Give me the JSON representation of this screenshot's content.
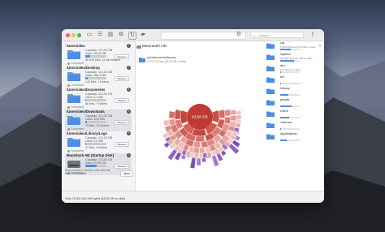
{
  "toolbar": {
    "search_placeholder": "Search"
  },
  "sidebar": {
    "cards": [
      {
        "title": "/Users/alex",
        "capacity": "Capacity: 121,03 GB",
        "used": "Used: 28,09 GB",
        "files": "56 640 files, 12 840 folders",
        "measure": "Measure",
        "status": "Completed",
        "usage": 0.23,
        "selected": false
      },
      {
        "title": "/Users/alex/Desktop",
        "capacity": "Capacity: 121,03 GB",
        "used": "Used: 465,3 MB",
        "files": "143 files, 7 folders",
        "measure": "Measure",
        "status": "Completed",
        "usage": 0.1,
        "selected": false
      },
      {
        "title": "/Users/alex/Documents",
        "capacity": "Capacity: 121,03 GB",
        "used": "Used: 3,1 MB",
        "files": "86 files, 7 folders",
        "measure": "Measure",
        "status": "Completed",
        "usage": 0.05,
        "selected": false
      },
      {
        "title": "/Users/alex/Downloads",
        "capacity": "Capacity: 121,03 GB",
        "used": "Used: 43,8 MB",
        "files": "79 files, 14 folders",
        "measure": "Measure",
        "status": "Completed",
        "usage": 0.07,
        "selected": true
      },
      {
        "title": "/Users/alex/Library/Logs",
        "capacity": "Capacity: 121,03 GB",
        "used": "Used: 6,6 MB",
        "files": "21 files, 8 folders",
        "measure": "Measure",
        "status": "Completed",
        "usage": 0.05,
        "selected": false
      },
      {
        "title": "Macintosh HD (Startup Disk)",
        "capacity": "Capacity: 121,03 GB",
        "used": "Used: 63,08 GB",
        "files": "",
        "measure": "Measure",
        "status": "Completed",
        "usage": 0.52,
        "selected": true
      }
    ],
    "drop_hint": "Drop a folder or volume on the side bar, then click Measure",
    "open_label": "Open"
  },
  "main": {
    "volume_title": "Macintosh HD",
    "help_label": "?",
    "current_path": "/private/var/folders/zz",
    "current_size": "4 376 792 files (63,08 GB on disk)",
    "center_label": "63,08 GB",
    "items": [
      {
        "name": "var",
        "size": "1 940 445 files (5,07 GB on disk)",
        "usage": 0.55
      },
      {
        "name": "System",
        "size": "402 881 files (8,3 GB on disk)",
        "usage": 0.7
      },
      {
        "name": "dev",
        "size": "0 (0 bytes on disk)",
        "usage": 0.02
      },
      {
        "name": "bin",
        "size": "...",
        "usage": 0.05
      },
      {
        "name": "Library",
        "size": "...",
        "usage": 0.4
      },
      {
        "name": "private",
        "size": "...",
        "usage": 0.6
      },
      {
        "name": "Users",
        "size": "...",
        "usage": 0.45
      },
      {
        "name": "Volumes",
        "size": "...",
        "usage": 0.02
      },
      {
        "name": "Applications",
        "size": "...",
        "usage": 0.35
      }
    ]
  },
  "footer": {
    "total": "Total 75 301 843 426 bytes (63,08 GB on disk)"
  },
  "colors": {
    "accent": "#4e8de0",
    "sunburst_core": "#c03a35"
  }
}
